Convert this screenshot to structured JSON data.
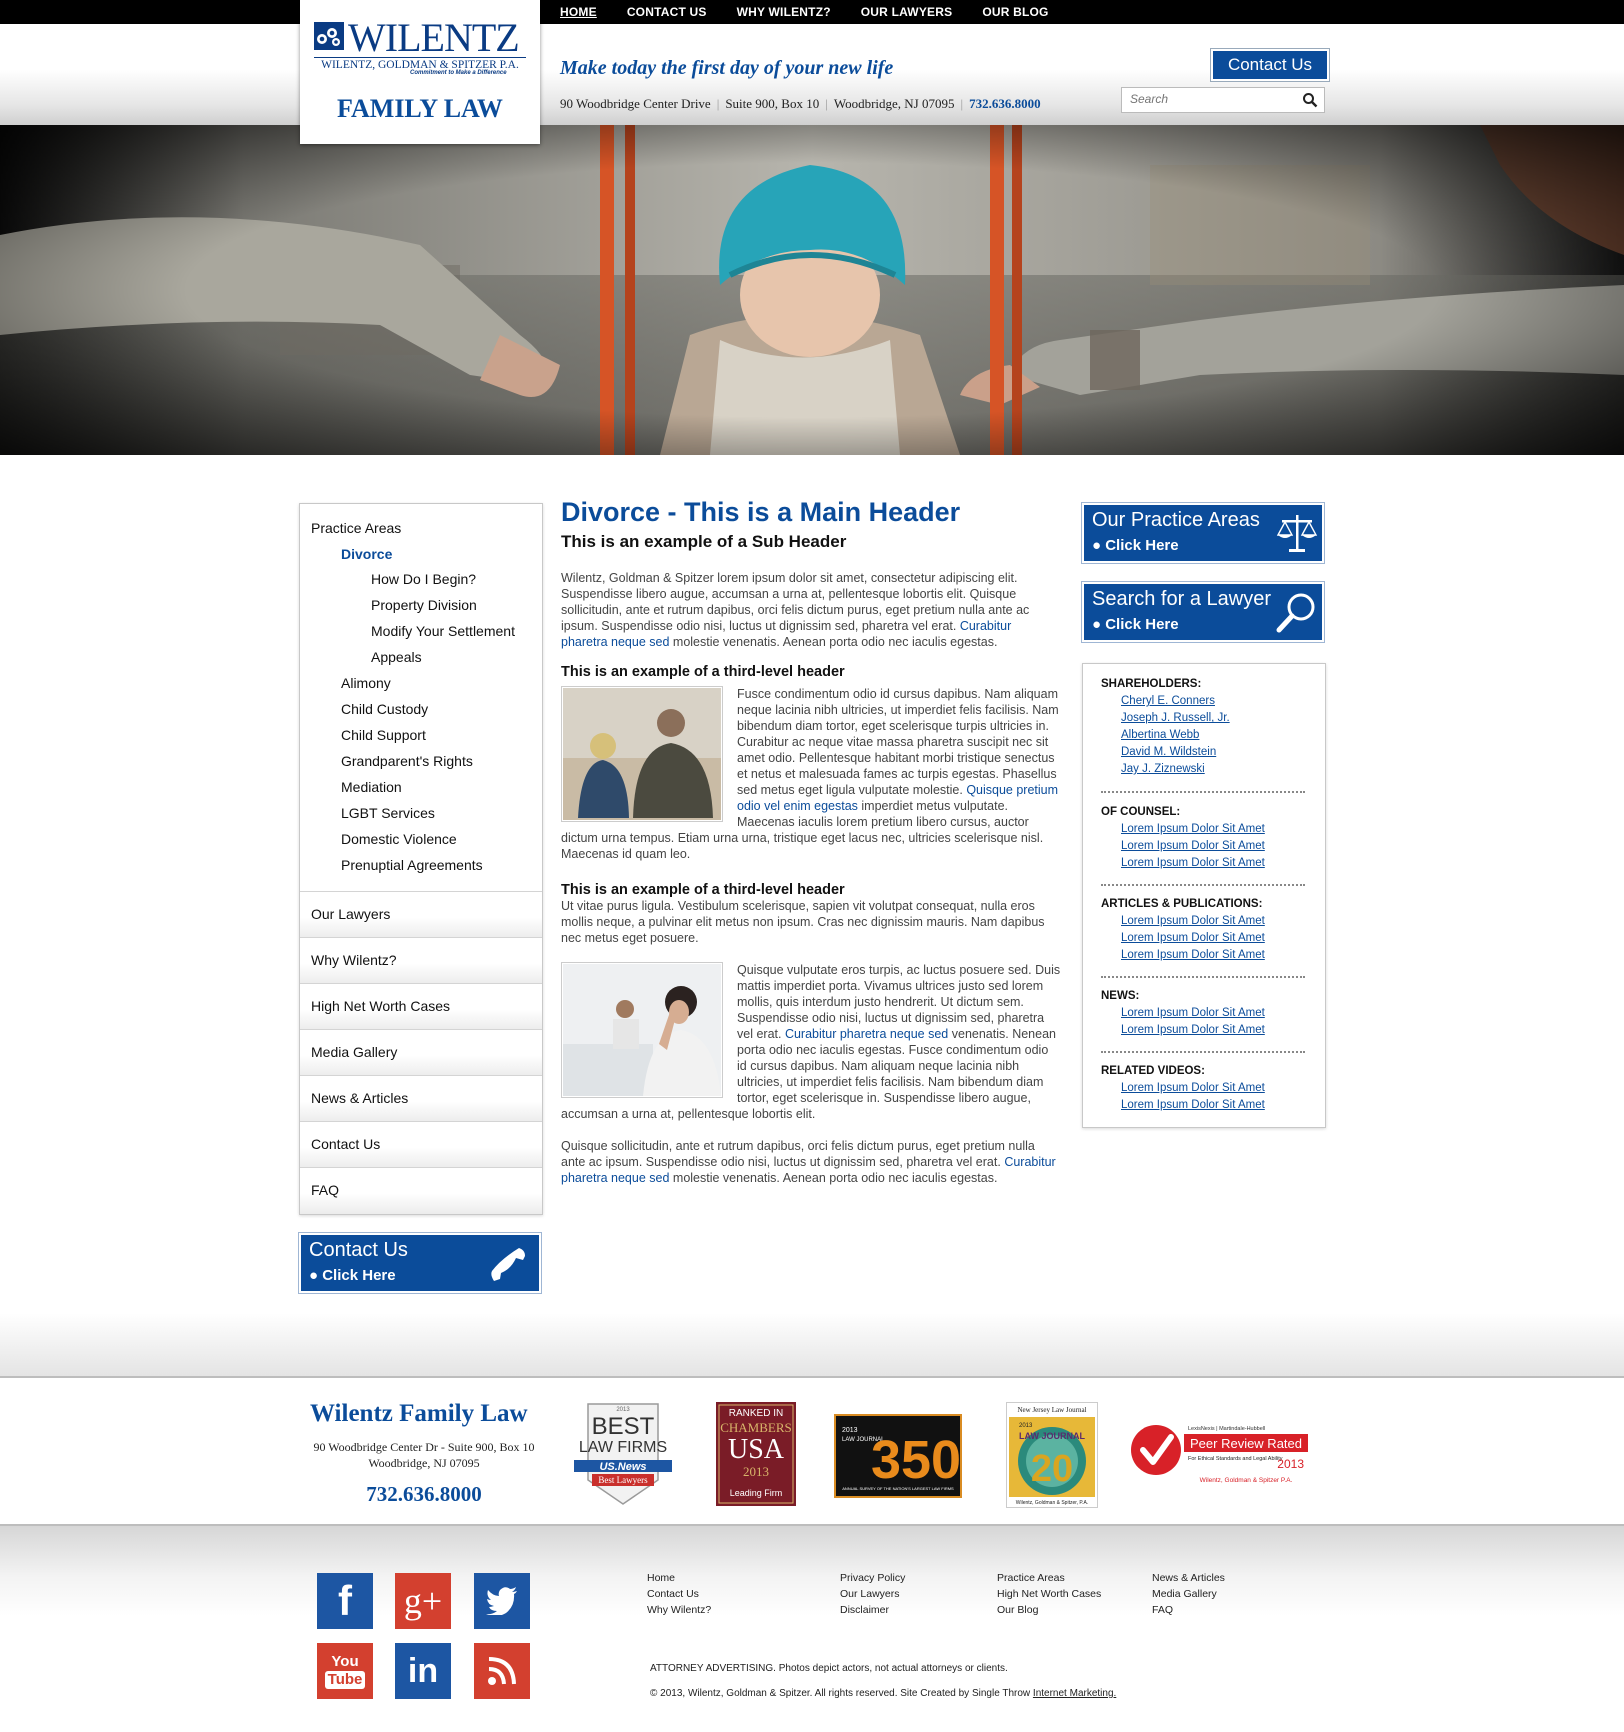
{
  "top_nav": [
    {
      "label": "HOME",
      "active": true
    },
    {
      "label": "CONTACT US",
      "active": false
    },
    {
      "label": "WHY WILENTZ?",
      "active": false
    },
    {
      "label": "OUR LAWYERS",
      "active": false
    },
    {
      "label": "OUR BLOG",
      "active": false
    }
  ],
  "logo": {
    "wordmark": "WILENTZ",
    "firm_name": "WILENTZ, GOLDMAN & SPITZER P.A.",
    "tagline": "Commitment to Make a Difference",
    "section": "FAMILY LAW"
  },
  "header": {
    "tagline": "Make today the first day of your new life",
    "address_street": "90 Woodbridge Center Drive",
    "address_suite": "Suite 900, Box 10",
    "address_city": "Woodbridge, NJ 07095",
    "phone": "732.636.8000",
    "contact_button": "Contact Us",
    "search_placeholder": "Search"
  },
  "left_nav": {
    "practice_areas": "Practice Areas",
    "divorce": "Divorce",
    "divorce_sub": [
      "How Do I Begin?",
      "Property Division",
      "Modify Your Settlement",
      "Appeals"
    ],
    "practice_items": [
      "Alimony",
      "Child Custody",
      "Child Support",
      "Grandparent's Rights",
      "Mediation",
      "LGBT Services",
      "Domestic Violence",
      "Prenuptial Agreements"
    ],
    "sections": [
      "Our Lawyers",
      "Why Wilentz?",
      "High Net Worth Cases",
      "Media Gallery",
      "News & Articles",
      "Contact Us",
      "FAQ"
    ]
  },
  "cta": {
    "contact_title": "Contact Us",
    "contact_sub": "● Click Here",
    "practice_title": "Our Practice Areas",
    "practice_sub": "● Click Here",
    "lawyer_title": "Search for a Lawyer",
    "lawyer_sub": "● Click Here"
  },
  "main": {
    "h1": "Divorce - This is a Main Header",
    "h2": "This is an example of a Sub Header",
    "p1": "Wilentz, Goldman & Spitzer lorem ipsum dolor sit amet, consectetur adipiscing elit. Suspendisse libero augue, accumsan a urna at, pellentesque lobortis elit. Quisque sollicitudin, ante et rutrum dapibus, orci felis dictum purus, eget pretium nulla ante ac ipsum. Suspendisse odio nisi, luctus ut dignissim sed, pharetra vel erat.",
    "p1_link": "Curabitur pharetra neque sed",
    "p1_end": "molestie venenatis. Aenean porta odio nec iaculis egestas.",
    "h3a": "This is an example of a third-level header",
    "p2": "Fusce condimentum odio id cursus dapibus. Nam aliquam neque lacinia nibh ultricies, ut imperdiet felis facilisis. Nam bibendum diam tortor, eget scelerisque turpis ultricies in. Curabitur ac neque vitae massa pharetra suscipit nec sit amet odio. Pellentesque habitant morbi tristique senectus et netus et malesuada fames ac turpis egestas. Phasellus sed metus eget ligula vulputate molestie.",
    "p2_link": "Quisque pretium odio vel enim egestas",
    "p2_end": "imperdiet metus vulputate. Maecenas iaculis lorem pretium libero cursus, auctor dictum urna tempus. Etiam urna urna, tristique eget lacus nec, ultricies scelerisque nisl. Maecenas id quam leo.",
    "h3b": "This is an example of a third-level header",
    "p3": "Ut vitae purus ligula. Vestibulum scelerisque, sapien vit volutpat consequat, nulla eros mollis neque, a pulvinar elit metus non ipsum. Cras nec dignissim mauris. Nam dapibus nec metus eget posuere.",
    "p4": "Quisque vulputate eros turpis, ac luctus posuere sed. Duis mattis imperdiet porta. Vivamus ultrices justo sed lorem mollis, quis interdum justo hendrerit. Ut dictum sem. Suspendisse odio nisi, luctus ut dignissim sed, pharetra vel erat.",
    "p4_link": "Curabitur pharetra neque sed",
    "p4_end": "venenatis. Nenean porta odio nec iaculis egestas. Fusce condimentum odio id cursus dapibus. Nam aliquam neque lacinia nibh ultricies, ut imperdiet felis facilisis. Nam bibendum diam tortor, eget scelerisque in. Suspendisse libero augue, accumsan a urna at, pellentesque lobortis elit.",
    "p5": "Quisque sollicitudin, ante et rutrum dapibus, orci felis dictum purus, eget pretium nulla ante ac ipsum. Suspendisse odio nisi, luctus ut dignissim sed, pharetra vel erat.",
    "p5_link": "Curabitur pharetra neque sed",
    "p5_end": "molestie venenatis. Aenean porta odio nec iaculis egestas."
  },
  "right_box": {
    "shareholders_head": "SHAREHOLDERS:",
    "shareholders": [
      "Cheryl E. Conners",
      "Joseph J. Russell, Jr.",
      "Albertina Webb",
      "David M. Wildstein",
      "Jay J. Ziznewski"
    ],
    "counsel_head": "OF COUNSEL:",
    "counsel": [
      "Lorem Ipsum Dolor Sit Amet",
      "Lorem Ipsum Dolor Sit Amet",
      "Lorem Ipsum Dolor Sit Amet"
    ],
    "articles_head": "ARTICLES & PUBLICATIONS:",
    "articles": [
      "Lorem Ipsum Dolor Sit Amet",
      "Lorem Ipsum Dolor Sit Amet",
      "Lorem Ipsum Dolor Sit Amet"
    ],
    "news_head": "NEWS:",
    "news": [
      "Lorem Ipsum Dolor Sit Amet",
      "Lorem Ipsum Dolor Sit Amet"
    ],
    "videos_head": "RELATED VIDEOS:",
    "videos": [
      "Lorem Ipsum Dolor Sit Amet",
      "Lorem Ipsum Dolor Sit Amet"
    ]
  },
  "footer_info": {
    "title": "Wilentz Family Law",
    "address1": "90 Woodbridge Center Dr - Suite 900, Box 10",
    "address2": "Woodbridge, NJ 07095",
    "phone": "732.636.8000"
  },
  "badges": {
    "usnews_year": "2013",
    "usnews_best": "BEST",
    "usnews_firms": "LAW FIRMS",
    "usnews_brand": "US.News",
    "usnews_lawyers": "Best Lawyers",
    "chambers_ranked": "RANKED IN",
    "chambers_name": "CHAMBERS",
    "chambers_usa": "USA",
    "chambers_year": "2013",
    "chambers_leading": "Leading Firm",
    "lj350_year": "2013",
    "lj350_brand": "LAW JOURNAL",
    "lj350_number": "350",
    "lj350_caption": "ANNUAL SURVEY OF THE NATION'S LARGEST LAW FIRMS",
    "njlj_title": "New Jersey Law Journal",
    "njlj_year": "2013",
    "njlj_brand": "LAW JOURNAL",
    "njlj_number": "20",
    "njlj_firm": "Wilentz, Goldman & Spitzer, P.A.",
    "lexis_brand": "LexisNexis | Martindale-Hubbell",
    "lexis_rated": "Peer Review Rated",
    "lexis_standards": "For Ethical Standards and Legal Ability",
    "lexis_year": "2013",
    "lexis_firm": "Wilentz, Goldman & Spitzer P.A."
  },
  "footer_links": {
    "col1": [
      "Home",
      "Contact Us",
      "Why Wilentz?"
    ],
    "col2": [
      "Privacy Policy",
      "Our Lawyers",
      "Disclaimer"
    ],
    "col3": [
      "Practice Areas",
      "High Net Worth Cases",
      "Our Blog"
    ],
    "col4": [
      "News & Articles",
      "Media Gallery",
      "FAQ"
    ]
  },
  "social": {
    "facebook": "f",
    "googleplus": "g+",
    "youtube_you": "You",
    "youtube_tube": "Tube",
    "linkedin": "in",
    "colors": {
      "facebook": "#1d56a3",
      "googleplus": "#d3402f",
      "twitter": "#1d56a3",
      "youtube": "#d3402f",
      "linkedin": "#1d56a3",
      "rss": "#d3402f"
    }
  },
  "legal": {
    "advertising": "ATTORNEY ADVERTISING. Photos depict actors, not actual attorneys or clients.",
    "copyright": "© 2013, Wilentz, Goldman & Spitzer. All rights reserved. Site Created by Single Throw",
    "copyright_link": "Internet Marketing."
  },
  "colors": {
    "brand_blue": "#0b4c9a",
    "top_bar": "#000000"
  }
}
